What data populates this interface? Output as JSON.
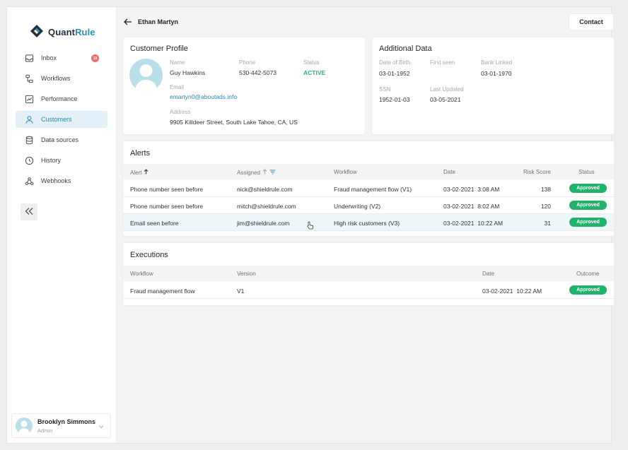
{
  "app": {
    "name_part1": "Quant",
    "name_part2": "Rule"
  },
  "sidebar": {
    "items": [
      {
        "label": "Inbox",
        "icon": "inbox-icon",
        "badge": "18"
      },
      {
        "label": "Workflows",
        "icon": "workflow-icon"
      },
      {
        "label": "Performance",
        "icon": "chart-icon"
      },
      {
        "label": "Customers",
        "icon": "user-icon",
        "active": true
      },
      {
        "label": "Data sources",
        "icon": "database-icon"
      },
      {
        "label": "History",
        "icon": "clock-icon"
      },
      {
        "label": "Webhooks",
        "icon": "webhook-icon"
      }
    ],
    "user": {
      "name": "Brooklyn Simmons",
      "role": "Admin"
    }
  },
  "header": {
    "title": "Ethan Martyn",
    "contact_label": "Contact"
  },
  "profile": {
    "title": "Customer Profile",
    "name_label": "Name",
    "name": "Guy Hawkins",
    "phone_label": "Phone",
    "phone": "530-442-5073",
    "status_label": "Status",
    "status": "ACTIVE",
    "email_label": "Email",
    "email": "emartyn0@aboutads.info",
    "address_label": "Address",
    "address": "9905 Killdeer Street, South Lake Tahoe, CA, US"
  },
  "additional": {
    "title": "Additional Data",
    "dob_label": "Date of Birth",
    "dob": "03-01-1952",
    "first_seen_label": "First seen",
    "first_seen": "",
    "bank_label": "Bank Linked",
    "bank": "03-01-1970",
    "ssn_label": "SSN",
    "ssn": "1952-01-03",
    "updated_label": "Last Updated",
    "updated": "03-05-2021"
  },
  "alerts": {
    "title": "Alerts",
    "columns": {
      "alert": "Alert",
      "assigned": "Assigned",
      "workflow": "Workflow",
      "date": "Date",
      "risk": "Risk Score",
      "status": "Status"
    },
    "rows": [
      {
        "alert": "Phone number seen before",
        "assigned": "nick@shieldrule.com",
        "workflow": "Fraud management flow (V1)",
        "date": "03-02-2021  3:08 AM",
        "risk": "138",
        "status": "Approved"
      },
      {
        "alert": "Phone number seen before",
        "assigned": "mitch@shieldrule.com",
        "workflow": "Underwriting (V2)",
        "date": "03-02-2021  8:02 AM",
        "risk": "120",
        "status": "Approved"
      },
      {
        "alert": "Email seen before",
        "assigned": "jim@shieldrule.com",
        "workflow": "High risk customers (V3)",
        "date": "03-02-2021  10:22 AM",
        "risk": "31",
        "status": "Approved"
      }
    ]
  },
  "executions": {
    "title": "Executions",
    "columns": {
      "workflow": "Workflow",
      "version": "Version",
      "date": "Date",
      "outcome": "Outcome"
    },
    "rows": [
      {
        "workflow": "Fraud management flow",
        "version": "V1",
        "date": "03-02-2021  10:22 AM",
        "outcome": "Approved"
      }
    ]
  },
  "colors": {
    "accent": "#2b86b3",
    "approved": "#23b26b",
    "status_active": "#2bb673",
    "badge": "#f26b6b"
  }
}
